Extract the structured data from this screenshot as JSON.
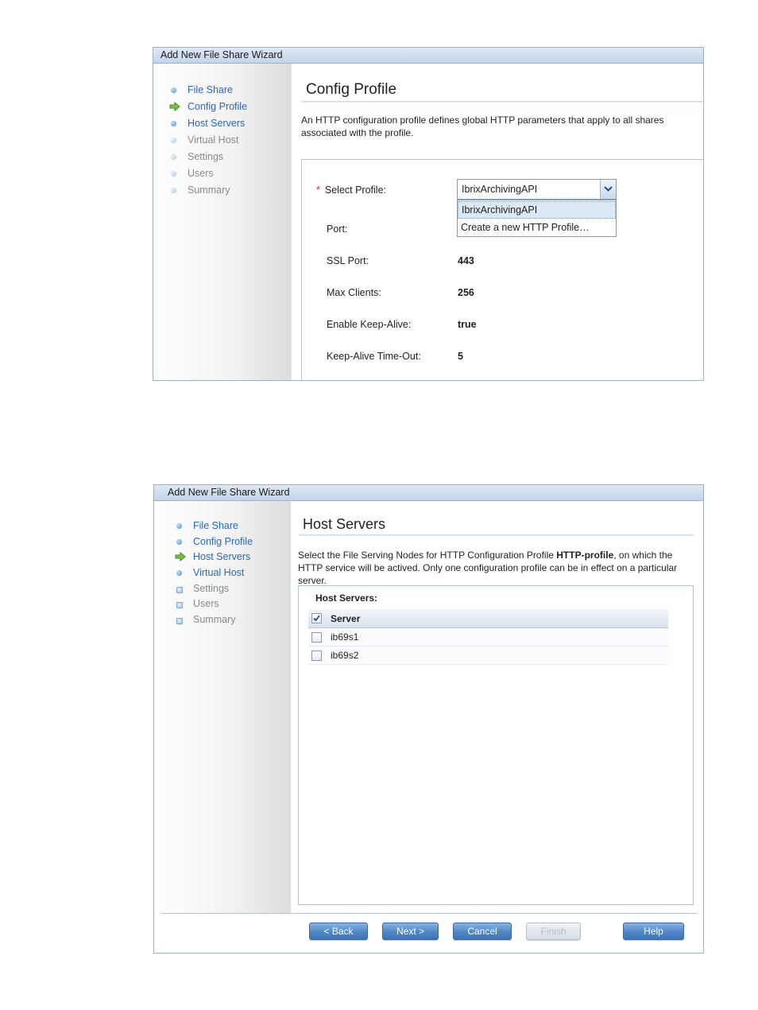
{
  "wizard1": {
    "title": "Add New File Share Wizard",
    "nav": [
      {
        "label": "File Share",
        "state": "done"
      },
      {
        "label": "Config Profile",
        "state": "current"
      },
      {
        "label": "Host Servers",
        "state": "done"
      },
      {
        "label": "Virtual Host",
        "state": "pending"
      },
      {
        "label": "Settings",
        "state": "pending"
      },
      {
        "label": "Users",
        "state": "pending"
      },
      {
        "label": "Summary",
        "state": "pending"
      }
    ],
    "heading": "Config Profile",
    "description": "An HTTP configuration profile defines global HTTP parameters that apply to all shares associated with the profile.",
    "required_marker": "*",
    "fields": {
      "select_profile_label": "Select Profile:",
      "select_profile_value": "IbrixArchivingAPI",
      "port_label": "Port:",
      "ssl_port_label": "SSL Port:",
      "ssl_port_value": "443",
      "max_clients_label": "Max Clients:",
      "max_clients_value": "256",
      "keep_alive_label": "Enable Keep-Alive:",
      "keep_alive_value": "true",
      "keep_alive_timeout_label": "Keep-Alive Time-Out:",
      "keep_alive_timeout_value": "5"
    },
    "dropdown_options": [
      "IbrixArchivingAPI",
      "Create a new HTTP Profile…"
    ]
  },
  "wizard2": {
    "title": "Add New File Share Wizard",
    "nav": [
      {
        "label": "File Share",
        "state": "done"
      },
      {
        "label": "Config Profile",
        "state": "done"
      },
      {
        "label": "Host Servers",
        "state": "current"
      },
      {
        "label": "Virtual Host",
        "state": "done"
      },
      {
        "label": "Settings",
        "state": "pending"
      },
      {
        "label": "Users",
        "state": "pending"
      },
      {
        "label": "Summary",
        "state": "pending"
      }
    ],
    "heading": "Host Servers",
    "description_pre": "Select the File Serving Nodes for HTTP Configuration Profile ",
    "description_bold": "HTTP-profile",
    "description_post": ", on which the HTTP service will be actived. Only one configuration profile can be in effect on a particular server.",
    "panel_label": "Host Servers:",
    "table_header": "Server",
    "header_checked": true,
    "servers": [
      {
        "name": "ib69s1",
        "checked": false
      },
      {
        "name": "ib69s2",
        "checked": false
      }
    ],
    "buttons": {
      "back": "< Back",
      "next": "Next >",
      "cancel": "Cancel",
      "finish": "Finish",
      "help": "Help"
    }
  },
  "colors": {
    "accent_blue": "#2d67b8",
    "required_red": "#d42a2a",
    "button_blue": "#4f86c6"
  }
}
